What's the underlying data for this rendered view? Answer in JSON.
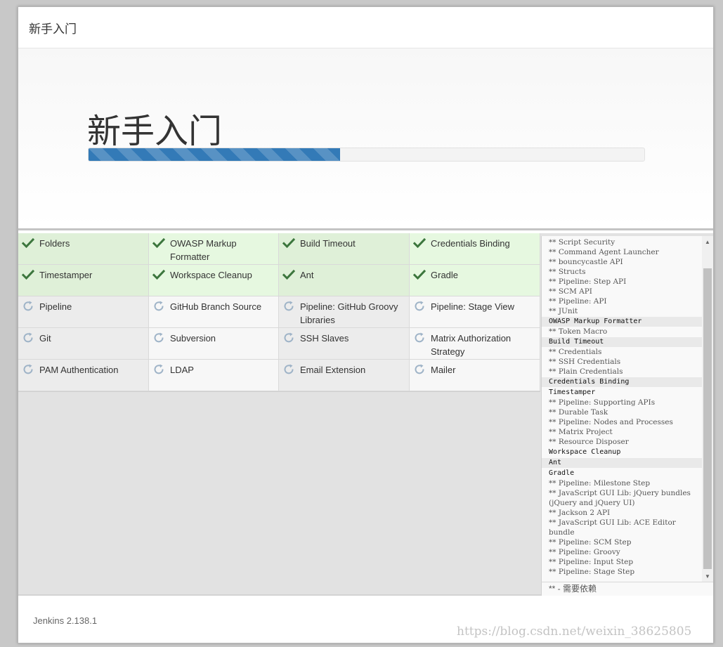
{
  "header": {
    "title": "新手入门"
  },
  "hero": {
    "title": "新手入门",
    "progress": 0.453
  },
  "plugins": [
    {
      "label": "Folders",
      "status": "success",
      "icon": "check-icon"
    },
    {
      "label": "OWASP Markup Formatter",
      "status": "success",
      "icon": "check-icon"
    },
    {
      "label": "Build Timeout",
      "status": "success",
      "icon": "check-icon"
    },
    {
      "label": "Credentials Binding",
      "status": "success",
      "icon": "check-icon"
    },
    {
      "label": "Timestamper",
      "status": "success",
      "icon": "check-icon"
    },
    {
      "label": "Workspace Cleanup",
      "status": "success",
      "icon": "check-icon"
    },
    {
      "label": "Ant",
      "status": "success",
      "icon": "check-icon"
    },
    {
      "label": "Gradle",
      "status": "success",
      "icon": "check-icon"
    },
    {
      "label": "Pipeline",
      "status": "pending",
      "icon": "refresh-icon"
    },
    {
      "label": "GitHub Branch Source",
      "status": "pending",
      "icon": "refresh-icon"
    },
    {
      "label": "Pipeline: GitHub Groovy Libraries",
      "status": "pending",
      "icon": "refresh-icon"
    },
    {
      "label": "Pipeline: Stage View",
      "status": "pending",
      "icon": "refresh-icon"
    },
    {
      "label": "Git",
      "status": "pending",
      "icon": "refresh-icon"
    },
    {
      "label": "Subversion",
      "status": "pending",
      "icon": "refresh-icon"
    },
    {
      "label": "SSH Slaves",
      "status": "pending",
      "icon": "refresh-icon"
    },
    {
      "label": "Matrix Authorization Strategy",
      "status": "pending",
      "icon": "refresh-icon"
    },
    {
      "label": "PAM Authentication",
      "status": "pending",
      "icon": "refresh-icon"
    },
    {
      "label": "LDAP",
      "status": "pending",
      "icon": "refresh-icon"
    },
    {
      "label": "Email Extension",
      "status": "pending",
      "icon": "refresh-icon"
    },
    {
      "label": "Mailer",
      "status": "pending",
      "icon": "refresh-icon"
    }
  ],
  "log": [
    {
      "text": "** Script Security",
      "top": false
    },
    {
      "text": "** Command Agent Launcher",
      "top": false
    },
    {
      "text": "** bouncycastle API",
      "top": false
    },
    {
      "text": "** Structs",
      "top": false
    },
    {
      "text": "** Pipeline: Step API",
      "top": false
    },
    {
      "text": "** SCM API",
      "top": false
    },
    {
      "text": "** Pipeline: API",
      "top": false
    },
    {
      "text": "** JUnit",
      "top": false
    },
    {
      "text": "OWASP Markup Formatter",
      "top": true,
      "shade": true
    },
    {
      "text": "** Token Macro",
      "top": false
    },
    {
      "text": "Build Timeout",
      "top": true,
      "shade": true
    },
    {
      "text": "** Credentials",
      "top": false
    },
    {
      "text": "** SSH Credentials",
      "top": false
    },
    {
      "text": "** Plain Credentials",
      "top": false
    },
    {
      "text": "Credentials Binding",
      "top": true,
      "shade": true
    },
    {
      "text": "Timestamper",
      "top": true,
      "shade": false
    },
    {
      "text": "** Pipeline: Supporting APIs",
      "top": false
    },
    {
      "text": "** Durable Task",
      "top": false
    },
    {
      "text": "** Pipeline: Nodes and Processes",
      "top": false
    },
    {
      "text": "** Matrix Project",
      "top": false
    },
    {
      "text": "** Resource Disposer",
      "top": false
    },
    {
      "text": "Workspace Cleanup",
      "top": true,
      "shade": false
    },
    {
      "text": "Ant",
      "top": true,
      "shade": true
    },
    {
      "text": "Gradle",
      "top": true,
      "shade": false
    },
    {
      "text": "** Pipeline: Milestone Step",
      "top": false
    },
    {
      "text": "** JavaScript GUI Lib: jQuery bundles (jQuery and jQuery UI)",
      "top": false
    },
    {
      "text": "** Jackson 2 API",
      "top": false
    },
    {
      "text": "** JavaScript GUI Lib: ACE Editor bundle",
      "top": false
    },
    {
      "text": "** Pipeline: SCM Step",
      "top": false
    },
    {
      "text": "** Pipeline: Groovy",
      "top": false
    },
    {
      "text": "** Pipeline: Input Step",
      "top": false
    },
    {
      "text": "** Pipeline: Stage Step",
      "top": false
    }
  ],
  "legend": "** - 需要依赖",
  "footer": {
    "version": "Jenkins 2.138.1"
  },
  "watermark": "https://blog.csdn.net/weixin_38625805",
  "colors": {
    "progress": "#337ab7",
    "success_bg": "#dff0d8",
    "check": "#3c763d",
    "pending_icon": "#9eb3c7"
  }
}
